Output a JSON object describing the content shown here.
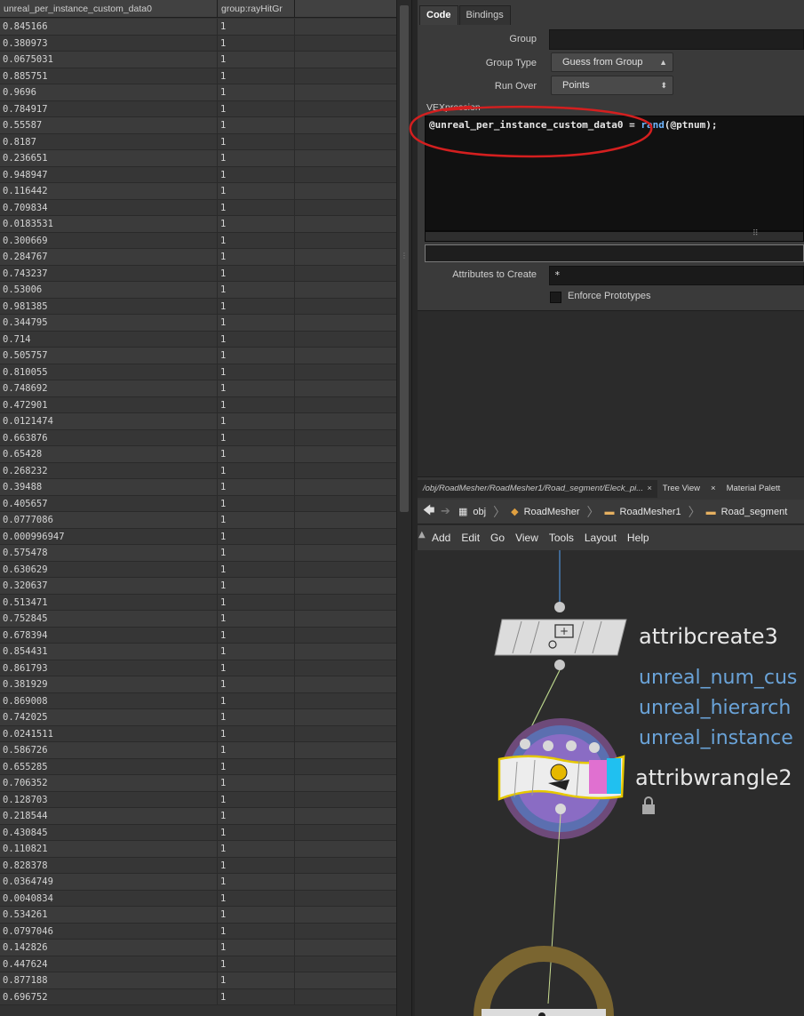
{
  "spreadsheet": {
    "columns": [
      "unreal_per_instance_custom_data0",
      "group:rayHitGr",
      ""
    ],
    "rows": [
      [
        "0.845166",
        "1"
      ],
      [
        "0.380973",
        "1"
      ],
      [
        "0.0675031",
        "1"
      ],
      [
        "0.885751",
        "1"
      ],
      [
        "0.9696",
        "1"
      ],
      [
        "0.784917",
        "1"
      ],
      [
        "0.55587",
        "1"
      ],
      [
        "0.8187",
        "1"
      ],
      [
        "0.236651",
        "1"
      ],
      [
        "0.948947",
        "1"
      ],
      [
        "0.116442",
        "1"
      ],
      [
        "0.709834",
        "1"
      ],
      [
        "0.0183531",
        "1"
      ],
      [
        "0.300669",
        "1"
      ],
      [
        "0.284767",
        "1"
      ],
      [
        "0.743237",
        "1"
      ],
      [
        "0.53006",
        "1"
      ],
      [
        "0.981385",
        "1"
      ],
      [
        "0.344795",
        "1"
      ],
      [
        "0.714",
        "1"
      ],
      [
        "0.505757",
        "1"
      ],
      [
        "0.810055",
        "1"
      ],
      [
        "0.748692",
        "1"
      ],
      [
        "0.472901",
        "1"
      ],
      [
        "0.0121474",
        "1"
      ],
      [
        "0.663876",
        "1"
      ],
      [
        "0.65428",
        "1"
      ],
      [
        "0.268232",
        "1"
      ],
      [
        "0.39488",
        "1"
      ],
      [
        "0.405657",
        "1"
      ],
      [
        "0.0777086",
        "1"
      ],
      [
        "0.000996947",
        "1"
      ],
      [
        "0.575478",
        "1"
      ],
      [
        "0.630629",
        "1"
      ],
      [
        "0.320637",
        "1"
      ],
      [
        "0.513471",
        "1"
      ],
      [
        "0.752845",
        "1"
      ],
      [
        "0.678394",
        "1"
      ],
      [
        "0.854431",
        "1"
      ],
      [
        "0.861793",
        "1"
      ],
      [
        "0.381929",
        "1"
      ],
      [
        "0.869008",
        "1"
      ],
      [
        "0.742025",
        "1"
      ],
      [
        "0.0241511",
        "1"
      ],
      [
        "0.586726",
        "1"
      ],
      [
        "0.655285",
        "1"
      ],
      [
        "0.706352",
        "1"
      ],
      [
        "0.128703",
        "1"
      ],
      [
        "0.218544",
        "1"
      ],
      [
        "0.430845",
        "1"
      ],
      [
        "0.110821",
        "1"
      ],
      [
        "0.828378",
        "1"
      ],
      [
        "0.0364749",
        "1"
      ],
      [
        "0.0040834",
        "1"
      ],
      [
        "0.534261",
        "1"
      ],
      [
        "0.0797046",
        "1"
      ],
      [
        "0.142826",
        "1"
      ],
      [
        "0.447624",
        "1"
      ],
      [
        "0.877188",
        "1"
      ],
      [
        "0.696752",
        "1"
      ]
    ]
  },
  "params": {
    "tabs": [
      "Code",
      "Bindings"
    ],
    "group_label": "Group",
    "group_type_label": "Group Type",
    "group_type_value": "Guess from Group",
    "run_over_label": "Run Over",
    "run_over_value": "Points",
    "vex_label": "VEXpression",
    "vex_code_attr": "@unreal_per_instance_custom_data0",
    "vex_code_eq": " = ",
    "vex_code_func": "rand",
    "vex_code_rest": "(@ptnum);",
    "attrs_to_create_label": "Attributes to Create",
    "attrs_to_create_value": "*",
    "enforce_prototypes_label": "Enforce Prototypes",
    "annotation_color": "#d41f1f"
  },
  "network": {
    "tabs": [
      {
        "label": "/obj/RoadMesher/RoadMesher1/Road_segment/Eleck_pi...",
        "close": "×"
      },
      {
        "label": "Tree View",
        "close": "×"
      },
      {
        "label": "Material Palett",
        "close": ""
      }
    ],
    "breadcrumbs": [
      "obj",
      "RoadMesher",
      "RoadMesher1",
      "Road_segment"
    ],
    "menu": [
      "Add",
      "Edit",
      "Go",
      "View",
      "Tools",
      "Layout",
      "Help"
    ],
    "nodes": {
      "attribcreate": {
        "name": "attribcreate3",
        "info": [
          "unreal_num_cus",
          "unreal_hierarch",
          "unreal_instance"
        ]
      },
      "attribwrangle": {
        "name": "attribwrangle2"
      }
    },
    "wire_color": "#4d8fd8"
  }
}
